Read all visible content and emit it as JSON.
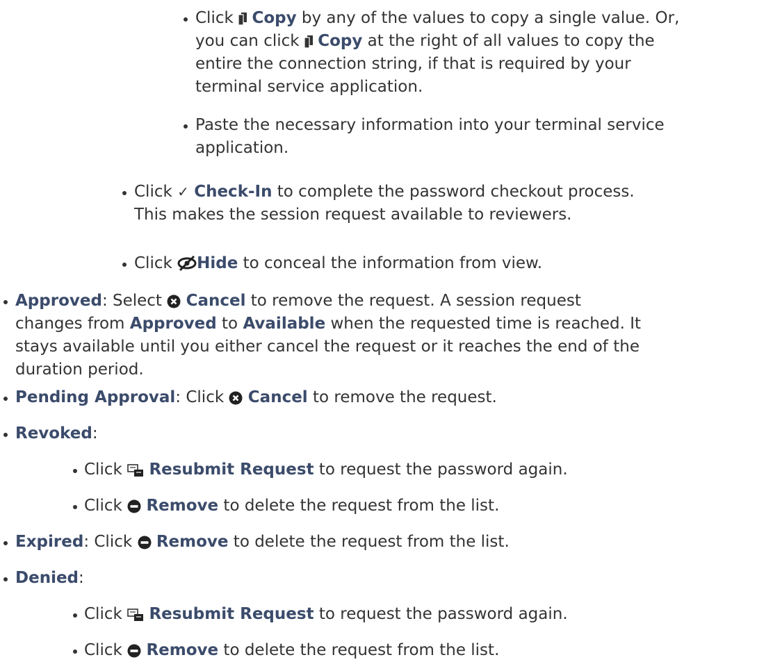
{
  "doc": {
    "copy_item": {
      "click": "Click",
      "copy": "Copy",
      "t1": "by any of the values to copy a single value. Or,",
      "t2": "you can click",
      "copy2": "Copy",
      "t3": "at the right of all values to copy the",
      "t4": "entire the connection string, if that is required by your",
      "t5": "terminal service application."
    },
    "paste_item": {
      "l1": "Paste the necessary information into your terminal service",
      "l2": "application."
    },
    "checkin_item": {
      "click": "Click",
      "label": "Check-In",
      "t1": "to complete the password checkout process.",
      "t2": "This makes the session request available to reviewers."
    },
    "hide_item": {
      "click": "Click",
      "label": "Hide",
      "t1": "to conceal the information from view."
    },
    "approved_item": {
      "term": "Approved",
      "sep": ": Select",
      "cancel": "Cancel",
      "t1": "to remove the request. A session request",
      "t2": "changes from",
      "approved": "Approved",
      "to": "to",
      "available": "Available",
      "t3": "when the requested time is reached. It",
      "t4": "stays available until you either cancel the request or it reaches the end of the",
      "t5": "duration period."
    },
    "pending_item": {
      "term": "Pending Approval",
      "sep": ": Click",
      "cancel": "Cancel",
      "t1": "to remove the request."
    },
    "revoked_item": {
      "term": "Revoked",
      "colon": ":"
    },
    "revoked_resubmit": {
      "click": "Click",
      "label": "Resubmit Request",
      "t1": "to request the password again."
    },
    "revoked_remove": {
      "click": "Click",
      "label": "Remove",
      "t1": "to delete the request from the list."
    },
    "expired_item": {
      "term": "Expired",
      "sep": ": Click",
      "remove": "Remove",
      "t1": "to delete the request from the list."
    },
    "denied_item": {
      "term": "Denied",
      "colon": ":"
    },
    "denied_resubmit": {
      "click": "Click",
      "label": "Resubmit Request",
      "t1": "to request the password again."
    },
    "denied_remove": {
      "click": "Click",
      "label": "Remove",
      "t1": "to delete the request from the list."
    }
  }
}
